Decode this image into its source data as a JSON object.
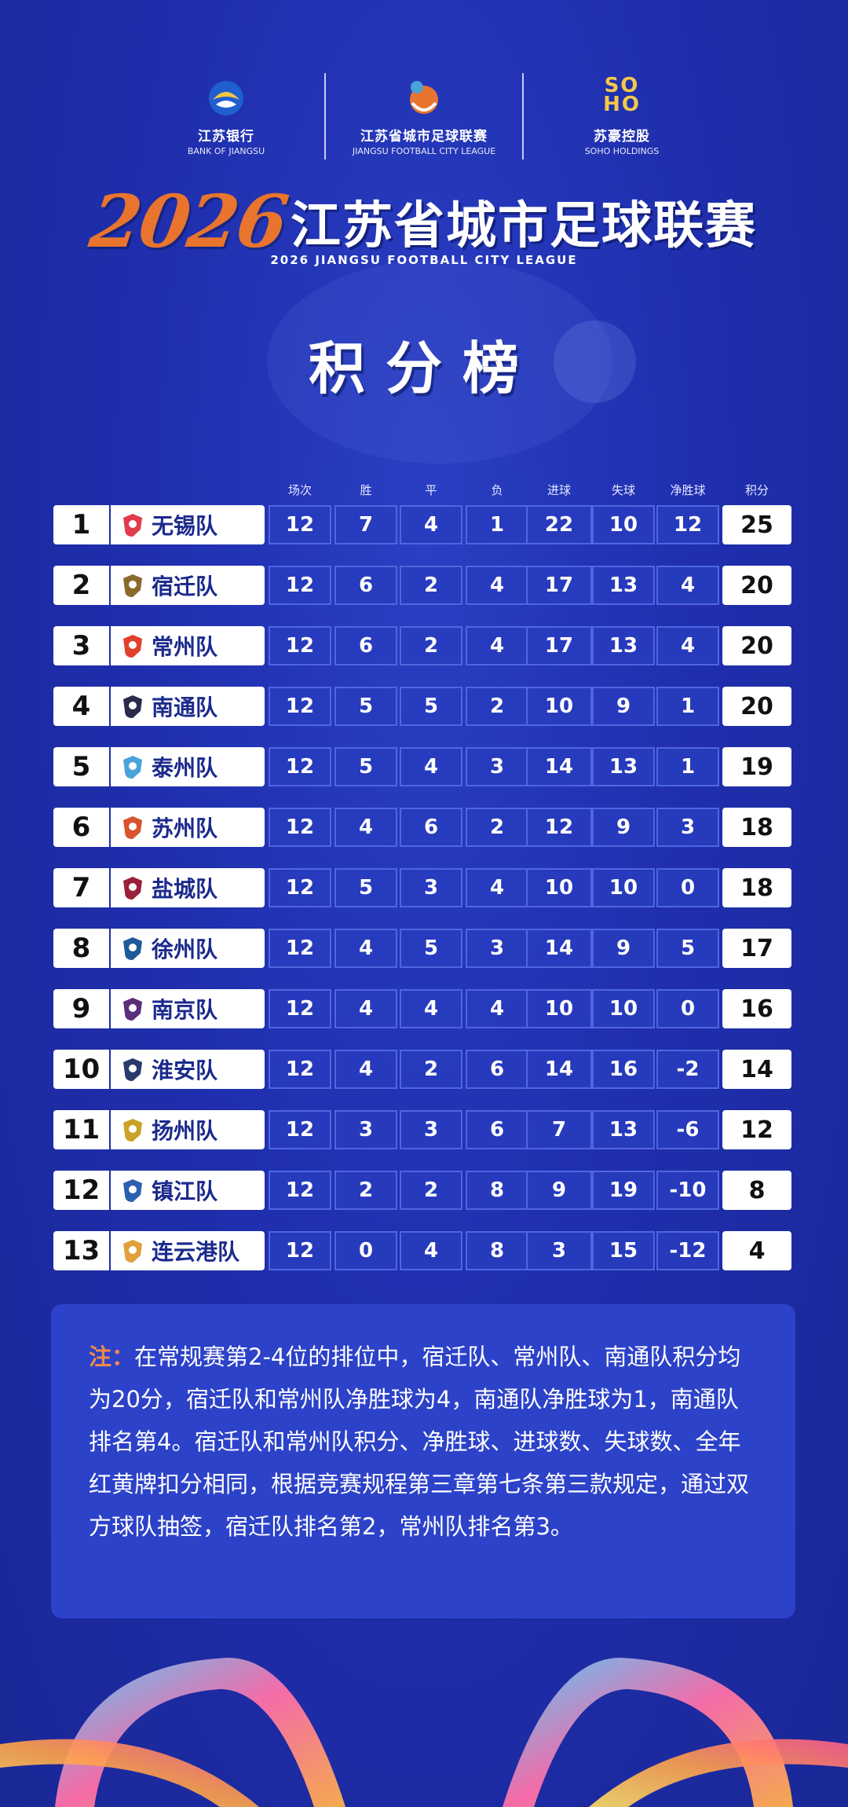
{
  "sponsors": [
    {
      "cn": "江苏银行",
      "en": "BANK OF JIANGSU"
    },
    {
      "cn": "江苏省城市足球联赛",
      "en": "JIANGSU FOOTBALL CITY LEAGUE"
    },
    {
      "cn": "苏豪控股",
      "en": "SOHO HOLDINGS",
      "mark": "SO HO"
    }
  ],
  "header": {
    "year": "2026",
    "league_cn": "江苏省城市足球联赛",
    "league_en": "2026 JIANGSU FOOTBALL CITY LEAGUE",
    "board_title": "积分榜"
  },
  "table": {
    "columns": [
      "场次",
      "胜",
      "平",
      "负",
      "进球",
      "失球",
      "净胜球",
      "积分"
    ],
    "rows": [
      {
        "rank": "1",
        "team": "无锡队",
        "played": "12",
        "won": "7",
        "drawn": "4",
        "lost": "1",
        "gf": "22",
        "ga": "10",
        "gd": "12",
        "pts": "25",
        "badge_color": "#e23b4c"
      },
      {
        "rank": "2",
        "team": "宿迁队",
        "played": "12",
        "won": "6",
        "drawn": "2",
        "lost": "4",
        "gf": "17",
        "ga": "13",
        "gd": "4",
        "pts": "20",
        "badge_color": "#8a6a2c"
      },
      {
        "rank": "3",
        "team": "常州队",
        "played": "12",
        "won": "6",
        "drawn": "2",
        "lost": "4",
        "gf": "17",
        "ga": "13",
        "gd": "4",
        "pts": "20",
        "badge_color": "#e0402c"
      },
      {
        "rank": "4",
        "team": "南通队",
        "played": "12",
        "won": "5",
        "drawn": "5",
        "lost": "2",
        "gf": "10",
        "ga": "9",
        "gd": "1",
        "pts": "20",
        "badge_color": "#2a2a4a"
      },
      {
        "rank": "5",
        "team": "泰州队",
        "played": "12",
        "won": "5",
        "drawn": "4",
        "lost": "3",
        "gf": "14",
        "ga": "13",
        "gd": "1",
        "pts": "19",
        "badge_color": "#4aa3d8"
      },
      {
        "rank": "6",
        "team": "苏州队",
        "played": "12",
        "won": "4",
        "drawn": "6",
        "lost": "2",
        "gf": "12",
        "ga": "9",
        "gd": "3",
        "pts": "18",
        "badge_color": "#d9532c"
      },
      {
        "rank": "7",
        "team": "盐城队",
        "played": "12",
        "won": "5",
        "drawn": "3",
        "lost": "4",
        "gf": "10",
        "ga": "10",
        "gd": "0",
        "pts": "18",
        "badge_color": "#9a1f3a"
      },
      {
        "rank": "8",
        "team": "徐州队",
        "played": "12",
        "won": "4",
        "drawn": "5",
        "lost": "3",
        "gf": "14",
        "ga": "9",
        "gd": "5",
        "pts": "17",
        "badge_color": "#1e5a9a"
      },
      {
        "rank": "9",
        "team": "南京队",
        "played": "12",
        "won": "4",
        "drawn": "4",
        "lost": "4",
        "gf": "10",
        "ga": "10",
        "gd": "0",
        "pts": "16",
        "badge_color": "#5a2e7a"
      },
      {
        "rank": "10",
        "team": "淮安队",
        "played": "12",
        "won": "4",
        "drawn": "2",
        "lost": "6",
        "gf": "14",
        "ga": "16",
        "gd": "-2",
        "pts": "14",
        "badge_color": "#2a3a6a"
      },
      {
        "rank": "11",
        "team": "扬州队",
        "played": "12",
        "won": "3",
        "drawn": "3",
        "lost": "6",
        "gf": "7",
        "ga": "13",
        "gd": "-6",
        "pts": "12",
        "badge_color": "#c9a227"
      },
      {
        "rank": "12",
        "team": "镇江队",
        "played": "12",
        "won": "2",
        "drawn": "2",
        "lost": "8",
        "gf": "9",
        "ga": "19",
        "gd": "-10",
        "pts": "8",
        "badge_color": "#2b5fb0"
      },
      {
        "rank": "13",
        "team": "连云港队",
        "played": "12",
        "won": "0",
        "drawn": "4",
        "lost": "8",
        "gf": "3",
        "ga": "15",
        "gd": "-12",
        "pts": "4",
        "badge_color": "#e0a03a"
      }
    ]
  },
  "note": {
    "label": "注：",
    "text": "在常规赛第2-4位的排位中，宿迁队、常州队、南通队积分均为20分，宿迁队和常州队净胜球为4，南通队净胜球为1，南通队排名第4。宿迁队和常州队积分、净胜球、进球数、失球数、全年红黄牌扣分相同，根据竞赛规程第三章第七条第三款规定，通过双方球队抽签，宿迁队排名第2，常州队排名第3。"
  }
}
